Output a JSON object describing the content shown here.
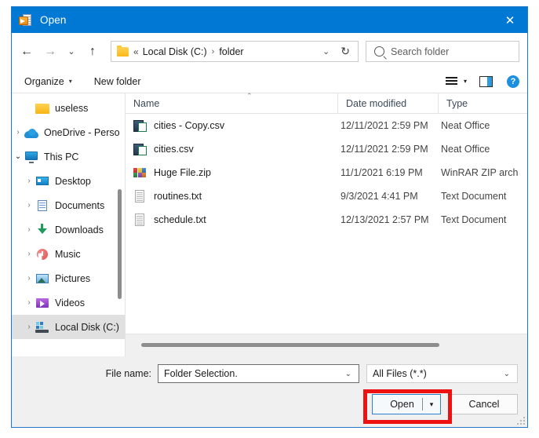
{
  "window": {
    "title": "Open",
    "title_icon": "open-folder-document-icon",
    "close_label": "✕",
    "accent_color": "#0078d4",
    "border_color": "#1f76c8"
  },
  "navbar": {
    "back_icon": "←",
    "forward_icon": "→",
    "recent_icon": "⌄",
    "up_icon": "↑",
    "address": {
      "folder_icon": "folder-icon",
      "chevrons": "«",
      "crumbs": [
        "Local Disk (C:)",
        "folder"
      ],
      "separator": "›",
      "caret": "⌄",
      "refresh_icon": "↻"
    },
    "search": {
      "placeholder": "Search folder",
      "icon": "search-icon"
    }
  },
  "toolbar": {
    "organize_label": "Organize",
    "organize_caret": "▾",
    "new_folder_label": "New folder",
    "view_icon": "view-options-icon",
    "view_caret": "▾",
    "preview_pane_icon": "preview-pane-icon",
    "help_label": "?"
  },
  "sidebar": {
    "items": [
      {
        "label": "useless",
        "icon": "folder-icon",
        "icon_class": "ic-folder",
        "chevron": "",
        "indent": 1,
        "selected": false
      },
      {
        "label": "OneDrive - Perso",
        "icon": "onedrive-cloud-icon",
        "icon_class": "ic-cloud",
        "chevron": "›",
        "indent": 0,
        "selected": false
      },
      {
        "label": "This PC",
        "icon": "this-pc-icon",
        "icon_class": "ic-pc",
        "chevron": "⌄",
        "indent": 0,
        "selected": false
      },
      {
        "label": "Desktop",
        "icon": "desktop-icon",
        "icon_class": "ic-desktop",
        "chevron": "›",
        "indent": 1,
        "selected": false
      },
      {
        "label": "Documents",
        "icon": "documents-icon",
        "icon_class": "ic-doc",
        "chevron": "›",
        "indent": 1,
        "selected": false
      },
      {
        "label": "Downloads",
        "icon": "downloads-icon",
        "icon_class": "ic-dl",
        "chevron": "›",
        "indent": 1,
        "selected": false
      },
      {
        "label": "Music",
        "icon": "music-icon",
        "icon_class": "ic-music",
        "chevron": "›",
        "indent": 1,
        "selected": false
      },
      {
        "label": "Pictures",
        "icon": "pictures-icon",
        "icon_class": "ic-pic",
        "chevron": "›",
        "indent": 1,
        "selected": false
      },
      {
        "label": "Videos",
        "icon": "videos-icon",
        "icon_class": "ic-vid",
        "chevron": "›",
        "indent": 1,
        "selected": false
      },
      {
        "label": "Local Disk (C:)",
        "icon": "local-disk-icon",
        "icon_class": "ic-disk",
        "chevron": "›",
        "indent": 1,
        "selected": true
      }
    ]
  },
  "file_list": {
    "columns": [
      "Name",
      "Date modified",
      "Type"
    ],
    "sort_caret": "⌃",
    "rows": [
      {
        "name": "cities - Copy.csv",
        "date": "12/11/2021 2:59 PM",
        "type": "Neat Office",
        "icon": "csv-file-icon",
        "icon_class": "ic-csv"
      },
      {
        "name": "cities.csv",
        "date": "12/11/2021 2:59 PM",
        "type": "Neat Office",
        "icon": "csv-file-icon",
        "icon_class": "ic-csv"
      },
      {
        "name": "Huge File.zip",
        "date": "11/1/2021 6:19 PM",
        "type": "WinRAR ZIP arch",
        "icon": "zip-archive-icon",
        "icon_class": "ic-zip"
      },
      {
        "name": "routines.txt",
        "date": "9/3/2021 4:41 PM",
        "type": "Text Document",
        "icon": "text-file-icon",
        "icon_class": "ic-txt"
      },
      {
        "name": "schedule.txt",
        "date": "12/13/2021 2:57 PM",
        "type": "Text Document",
        "icon": "text-file-icon",
        "icon_class": "ic-txt"
      }
    ]
  },
  "footer": {
    "file_name_label": "File name:",
    "file_name_value": "Folder Selection.",
    "file_name_caret": "⌄",
    "filter_value": "All Files (*.*)",
    "filter_caret": "⌄",
    "open_label": "Open",
    "open_split_caret": "▾",
    "cancel_label": "Cancel"
  },
  "annotation": {
    "highlight_color": "#ee1111",
    "target": "open-button"
  }
}
